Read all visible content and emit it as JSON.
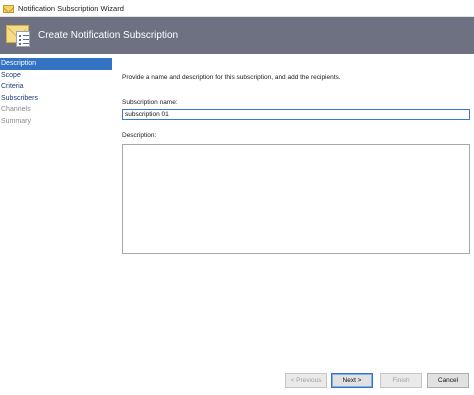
{
  "window": {
    "title": "Notification Subscription Wizard"
  },
  "banner": {
    "heading": "Create Notification Subscription"
  },
  "nav": {
    "items": [
      {
        "label": "Description",
        "state": "active"
      },
      {
        "label": "Scope",
        "state": "enabled"
      },
      {
        "label": "Criteria",
        "state": "enabled"
      },
      {
        "label": "Subscribers",
        "state": "enabled"
      },
      {
        "label": "Channels",
        "state": "disabled"
      },
      {
        "label": "Summary",
        "state": "disabled"
      }
    ]
  },
  "form": {
    "intro": "Provide a name and description for this subscription, and add the recipients.",
    "name_label": "Subscription name:",
    "name_value": "subscription 01",
    "description_label": "Description:",
    "description_value": ""
  },
  "buttons": {
    "previous": "< Previous",
    "next": "Next >",
    "finish": "Finish",
    "cancel": "Cancel"
  },
  "colors": {
    "banner_bg": "#6d7182",
    "nav_active_bg": "#3473c4",
    "link_text": "#1f3a7a"
  }
}
